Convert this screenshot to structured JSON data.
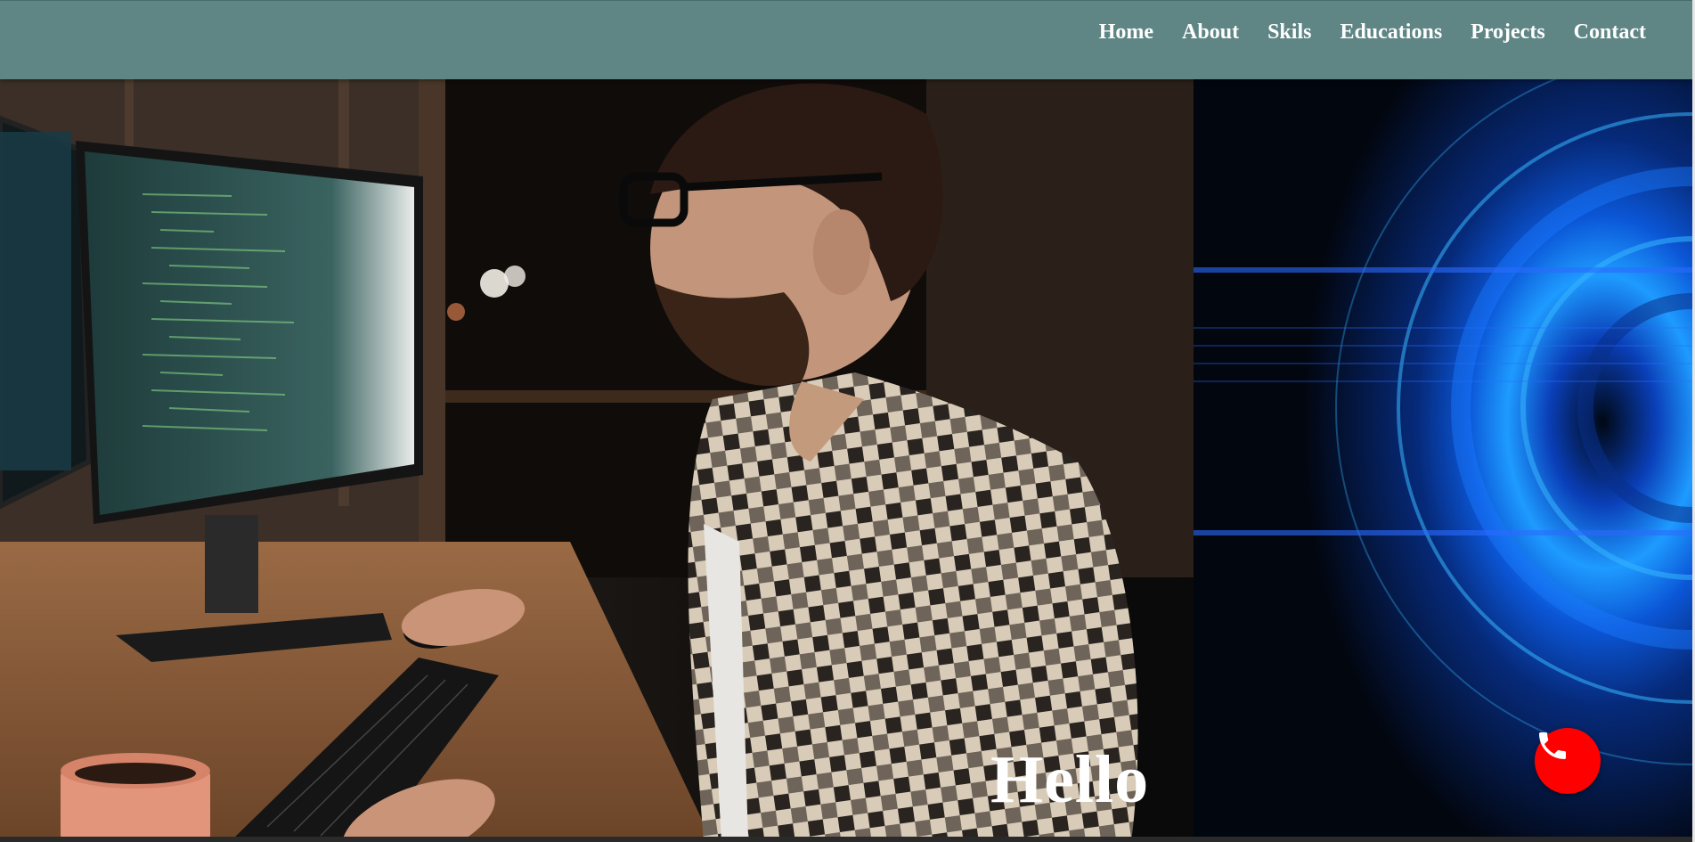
{
  "nav": {
    "items": [
      {
        "label": "Home"
      },
      {
        "label": "About"
      },
      {
        "label": "Skils"
      },
      {
        "label": "Educations"
      },
      {
        "label": "Projects"
      },
      {
        "label": "Contact"
      }
    ]
  },
  "hero": {
    "greeting": "Hello",
    "image_alt": "developer-at-computer-photo",
    "decor": "blue-tech-circle-graphic"
  },
  "call_button": {
    "icon": "phone-icon",
    "color": "#ff0000"
  },
  "colors": {
    "navbar": "#5f8585",
    "accent": "#ff0000"
  }
}
